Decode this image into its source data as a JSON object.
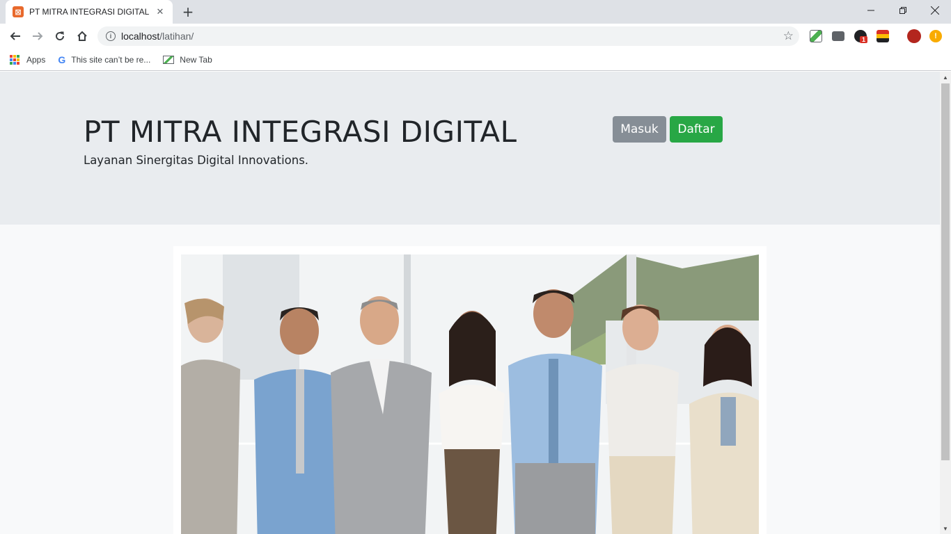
{
  "browser": {
    "tab_title": "PT MITRA INTEGRASI DIGITAL",
    "url_host": "localhost",
    "url_path": "/latihan/",
    "bookmarks": [
      {
        "label": "Apps",
        "icon": "apps-grid-icon"
      },
      {
        "label": "This site can’t be re...",
        "icon": "google-icon"
      },
      {
        "label": "New Tab",
        "icon": "new-tab-icon"
      }
    ],
    "extension_badge": "1",
    "profile_alert": "!"
  },
  "page": {
    "title": "PT MITRA INTEGRASI DIGITAL",
    "lead": "Layanan Sinergitas Digital Innovations.",
    "buttons": {
      "login": "Masuk",
      "register": "Daftar"
    },
    "colors": {
      "jumbotron_bg": "#e9ecef",
      "login_btn": "#868e96",
      "register_btn": "#28a745"
    }
  },
  "hero_image": {
    "description_icon": "team-photo"
  }
}
